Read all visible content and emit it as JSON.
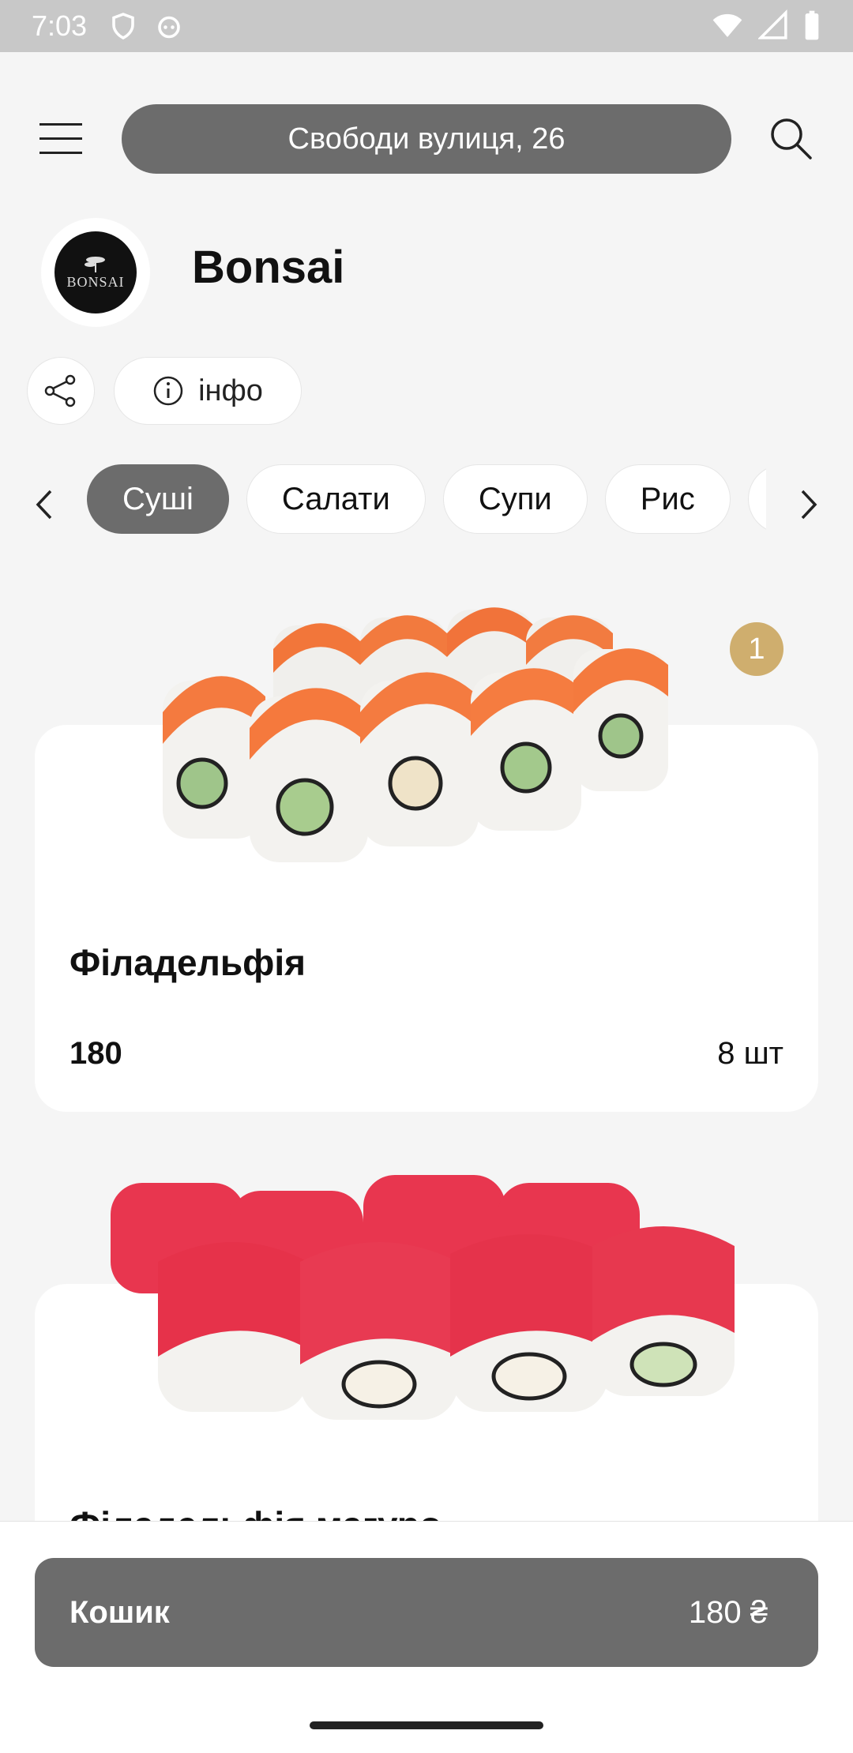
{
  "status_bar": {
    "time": "7:03"
  },
  "header": {
    "address": "Свободи вулиця, 26"
  },
  "restaurant": {
    "name": "Bonsai",
    "logo_text": "BONSAI",
    "info_label": "інфо"
  },
  "categories": [
    {
      "label": "Суші",
      "active": true
    },
    {
      "label": "Салати",
      "active": false
    },
    {
      "label": "Супи",
      "active": false
    },
    {
      "label": "Рис",
      "active": false
    },
    {
      "label": "",
      "active": false
    }
  ],
  "products": [
    {
      "name": "Філадельфія",
      "price": "180",
      "quantity": "8 шт",
      "in_cart_count": "1",
      "image": "salmon-sushi-rolls"
    },
    {
      "name": "Філадельфія магуро",
      "image": "tuna-sushi-rolls"
    }
  ],
  "cart": {
    "label": "Кошик",
    "total": "180 ₴"
  },
  "colors": {
    "accent_gray": "#6c6c6c",
    "badge_gold": "#cfae6e",
    "background": "#f5f5f5"
  }
}
